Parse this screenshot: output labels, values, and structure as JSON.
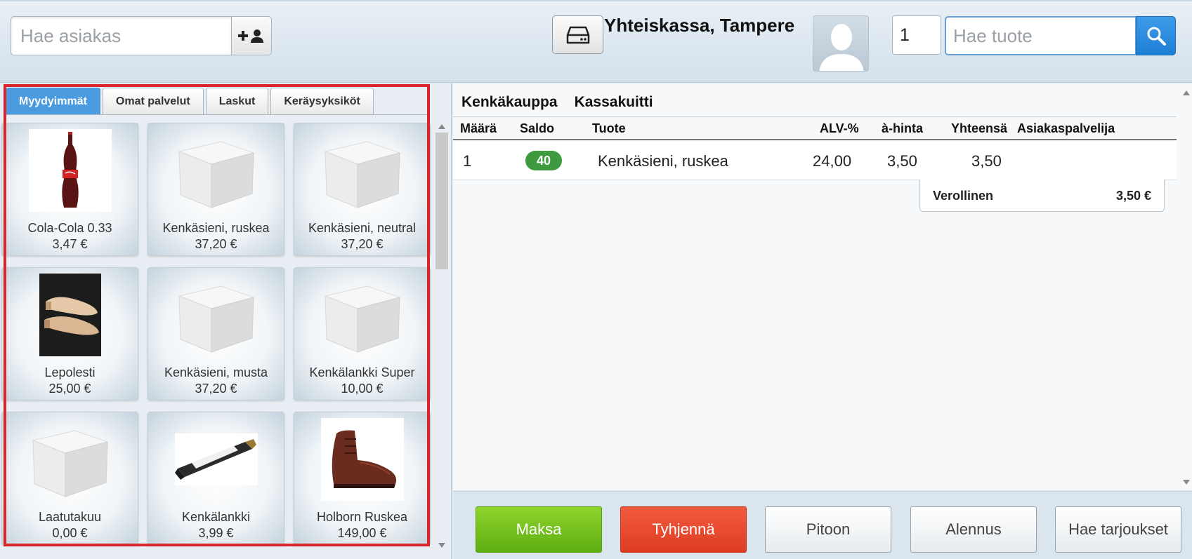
{
  "header": {
    "customer_search_placeholder": "Hae asiakas",
    "store_title": "Yhteiskassa, Tampere",
    "quantity_value": "1",
    "product_search_placeholder": "Hae tuote"
  },
  "product_tabs": [
    {
      "label": "Myydyimmät",
      "active": true
    },
    {
      "label": "Omat palvelut",
      "active": false
    },
    {
      "label": "Laskut",
      "active": false
    },
    {
      "label": "Keräysyksiköt",
      "active": false
    }
  ],
  "products": [
    {
      "name": "Cola-Cola 0.33",
      "price": "3,47 €",
      "image": "cola-bottle"
    },
    {
      "name": "Kenkäsieni, ruskea",
      "price": "37,20 €",
      "image": "box"
    },
    {
      "name": "Kenkäsieni, neutral",
      "price": "37,20 €",
      "image": "box"
    },
    {
      "name": "Lepolesti",
      "price": "25,00 €",
      "image": "shoe-tree"
    },
    {
      "name": "Kenkäsieni, musta",
      "price": "37,20 €",
      "image": "box"
    },
    {
      "name": "Kenkälankki Super",
      "price": "10,00 €",
      "image": "box"
    },
    {
      "name": "Laatutakuu",
      "price": "0,00 €",
      "image": "box"
    },
    {
      "name": "Kenkälankki",
      "price": "3,99 €",
      "image": "polish-tube"
    },
    {
      "name": "Holborn Ruskea",
      "price": "149,00 €",
      "image": "brown-boot"
    }
  ],
  "receipt": {
    "tabs": [
      "Kenkäkauppa",
      "Kassakuitti"
    ],
    "columns": [
      "Määrä",
      "Saldo",
      "Tuote",
      "ALV-%",
      "à-hinta",
      "Yhteensä",
      "Asiakaspalvelija"
    ],
    "rows": [
      {
        "qty": "1",
        "saldo": "40",
        "product": "Kenkäsieni, ruskea",
        "vat": "24,00",
        "unit_price": "3,50",
        "total": "3,50",
        "clerk": ""
      }
    ],
    "total_label": "Verollinen",
    "total_value": "3,50 €"
  },
  "actions": {
    "pay": "Maksa",
    "clear": "Tyhjennä",
    "hold": "Pitoon",
    "discount": "Alennus",
    "offers": "Hae tarjoukset"
  },
  "colors": {
    "active_tab": "#4a9be0",
    "pay": "#6cbd18",
    "clear": "#e8492d",
    "saldo_badge": "#3f9a3f",
    "highlight": "#d9252b"
  }
}
